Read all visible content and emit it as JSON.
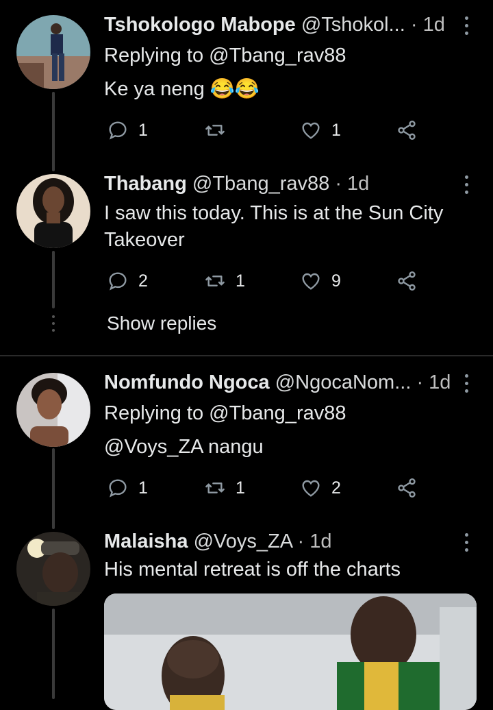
{
  "colors": {
    "background": "#000000",
    "text": "#e7e9ea",
    "icon": "#8f9aa3",
    "divider": "#2a2a2a"
  },
  "tweets": [
    {
      "name": "Tshokologo Mabope",
      "handle": "@Tshokol...",
      "time": "· 1d",
      "reply_to": "Replying to @Tbang_rav88",
      "text": [
        "Ke ya neng 😂😂"
      ],
      "replies": "1",
      "retweets": "",
      "likes": "1"
    },
    {
      "name": "Thabang",
      "handle": "@Tbang_rav88",
      "time": "· 1d",
      "text": [
        "I saw this today. This is at the Sun City",
        "Takeover"
      ],
      "replies": "2",
      "retweets": "1",
      "likes": "9",
      "show_replies": "Show replies"
    },
    {
      "name": "Nomfundo Ngoca",
      "handle": "@NgocaNom...",
      "time": "· 1d",
      "reply_to": "Replying to @Tbang_rav88",
      "text": [
        "@Voys_ZA nangu"
      ],
      "replies": "1",
      "retweets": "1",
      "likes": "2"
    },
    {
      "name": "Malaisha",
      "handle": "@Voys_ZA",
      "time": "· 1d",
      "text": [
        "His mental retreat is off the charts"
      ],
      "media": "photo"
    }
  ],
  "icons": [
    "reply-icon",
    "retweet-icon",
    "like-icon",
    "share-icon",
    "more-options-icon"
  ]
}
